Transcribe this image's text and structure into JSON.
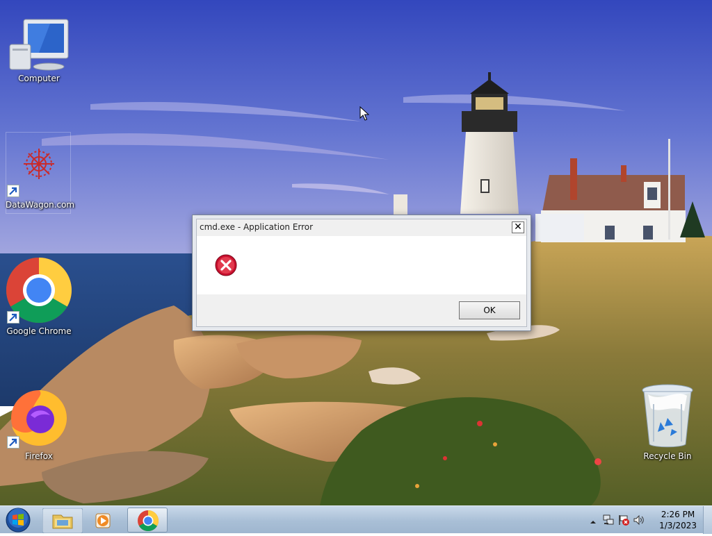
{
  "desktop": {
    "icons": [
      {
        "label": "Computer",
        "icon": "computer-icon"
      },
      {
        "label": "DataWagon.com",
        "icon": "datawagon-icon"
      },
      {
        "label": "Google Chrome",
        "icon": "chrome-icon"
      },
      {
        "label": "Firefox",
        "icon": "firefox-icon"
      },
      {
        "label": "Recycle Bin",
        "icon": "recycle-bin-icon"
      }
    ]
  },
  "dialog": {
    "title": "cmd.exe - Application Error",
    "close_symbol": "✕",
    "message": "",
    "icon": "error-icon",
    "ok_label": "OK"
  },
  "taskbar": {
    "start": "start-orb-icon",
    "pinned": [
      "file-explorer-icon",
      "media-player-icon",
      "chrome-icon"
    ],
    "active": "chrome-icon",
    "tray_icons": [
      "show-hidden-icons-arrow",
      "network-icon",
      "action-center-flag-icon",
      "volume-icon"
    ],
    "time": "2:26 PM",
    "date": "1/3/2023"
  },
  "colors": {
    "error_red": "#c8102e",
    "taskbar": "#a9bfd6",
    "sky": "#4a5fc4",
    "sea": "#2a4f8e"
  }
}
